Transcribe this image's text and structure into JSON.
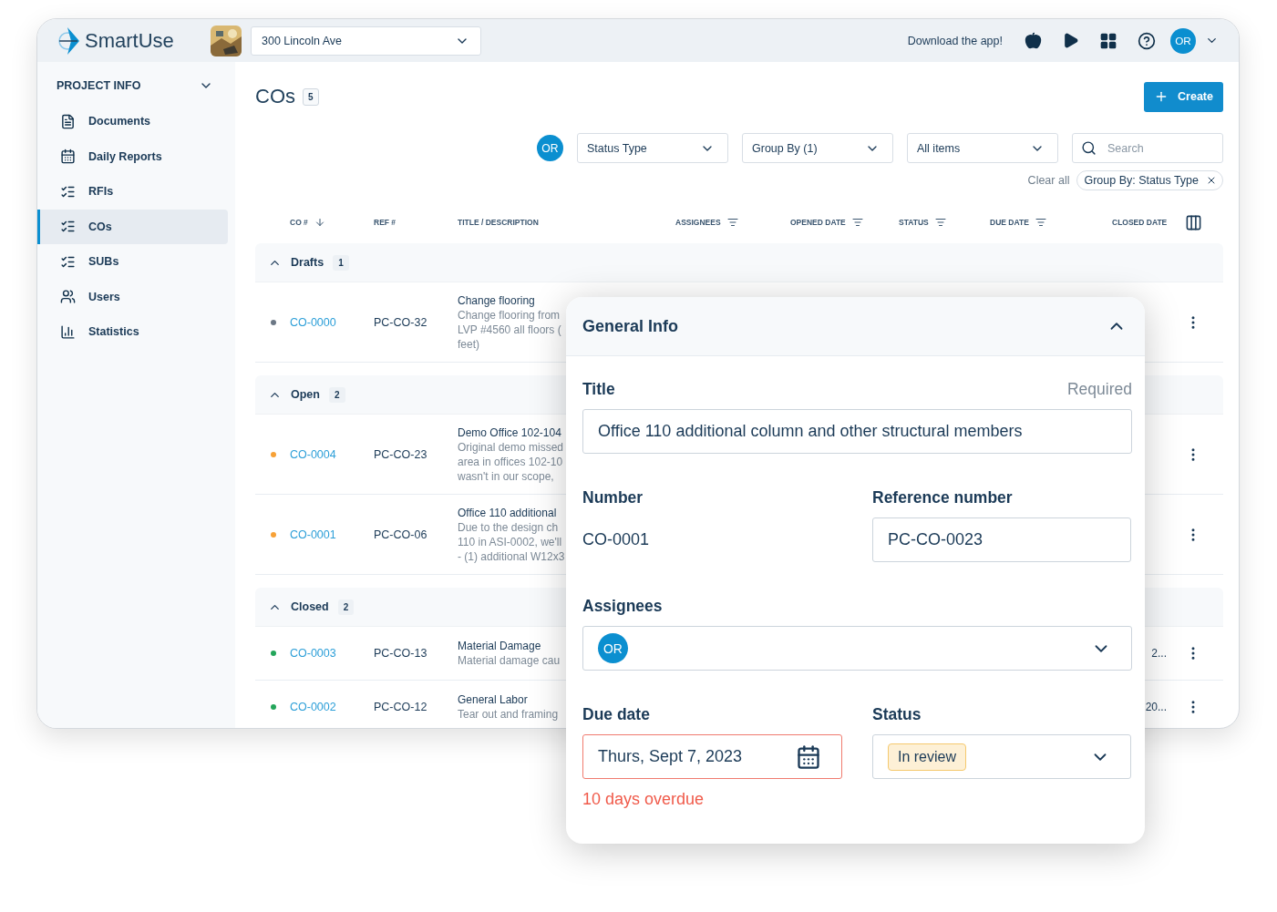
{
  "topbar": {
    "logo": "SmartUse",
    "project": "300 Lincoln Ave",
    "download": "Download the app!",
    "user": "OR"
  },
  "sidebar": {
    "header": "PROJECT INFO",
    "items": [
      {
        "label": "Documents",
        "selected": false
      },
      {
        "label": "Daily Reports",
        "selected": false
      },
      {
        "label": "RFIs",
        "selected": false
      },
      {
        "label": "COs",
        "selected": true
      },
      {
        "label": "SUBs",
        "selected": false
      },
      {
        "label": "Users",
        "selected": false
      },
      {
        "label": "Statistics",
        "selected": false
      }
    ]
  },
  "page": {
    "title": "COs",
    "count": "5",
    "create": "Create"
  },
  "filters": {
    "avatar": "OR",
    "selects": [
      "Status Type",
      "Group By (1)",
      "All items"
    ],
    "search_placeholder": "Search",
    "clear": "Clear all",
    "chip": "Group By: Status Type"
  },
  "table": {
    "columns": [
      {
        "label": "CO #",
        "kind": "sortable"
      },
      {
        "label": "REF #",
        "kind": "plain"
      },
      {
        "label": "TITLE / DESCRIPTION",
        "kind": "plain"
      },
      {
        "label": "ASSIGNEES",
        "kind": "filterable"
      },
      {
        "label": "OPENED DATE",
        "kind": "filterable"
      },
      {
        "label": "STATUS",
        "kind": "filterable"
      },
      {
        "label": "DUE DATE",
        "kind": "filterable"
      },
      {
        "label": "CLOSED DATE",
        "kind": "plain"
      }
    ],
    "groups": [
      {
        "name": "Drafts",
        "count": "1",
        "expanded": true,
        "rows": [
          {
            "color": "#6b7785",
            "co": "CO-0000",
            "ref": "PC-CO-32",
            "title": "Change flooring",
            "description": [
              "Change flooring from",
              "LVP #4560 all floors (",
              "feet)"
            ]
          }
        ]
      },
      {
        "name": "Open",
        "count": "2",
        "expanded": true,
        "rows": [
          {
            "color": "#f7a136",
            "co": "CO-0004",
            "ref": "PC-CO-23",
            "title": "Demo Office 102-104",
            "description": [
              "Original demo missed",
              "area in offices 102-10",
              "wasn't in our scope,"
            ]
          },
          {
            "color": "#f7a136",
            "co": "CO-0001",
            "ref": "PC-CO-06",
            "title": "Office 110 additional",
            "description": [
              "Due to the design ch",
              "110 in ASI-0002, we'll",
              "- (1) additional W12x3"
            ]
          }
        ]
      },
      {
        "name": "Closed",
        "count": "2",
        "expanded": true,
        "rows": [
          {
            "color": "#23a55a",
            "co": "CO-0003",
            "ref": "PC-CO-13",
            "title": "Material Damage",
            "description": [
              "Material damage cau"
            ],
            "closed": "2..."
          },
          {
            "color": "#23a55a",
            "co": "CO-0002",
            "ref": "PC-CO-12",
            "title": "General Labor",
            "description": [
              "Tear out and framing"
            ],
            "closed": "20..."
          }
        ]
      }
    ]
  },
  "card": {
    "title": "General Info",
    "expanded": true,
    "title_field": {
      "label": "Title",
      "hint": "Required",
      "value": "Office 110 additional column and other structural members"
    },
    "number": {
      "label": "Number",
      "value": "CO-0001"
    },
    "reference": {
      "label": "Reference number",
      "value": "PC-CO-0023"
    },
    "assignees": {
      "label": "Assignees",
      "avatar": "OR"
    },
    "due_date": {
      "label": "Due date",
      "value": "Thurs, Sept 7, 2023",
      "overdue": true,
      "error": "10 days overdue"
    },
    "status": {
      "label": "Status",
      "value": "In review"
    }
  }
}
